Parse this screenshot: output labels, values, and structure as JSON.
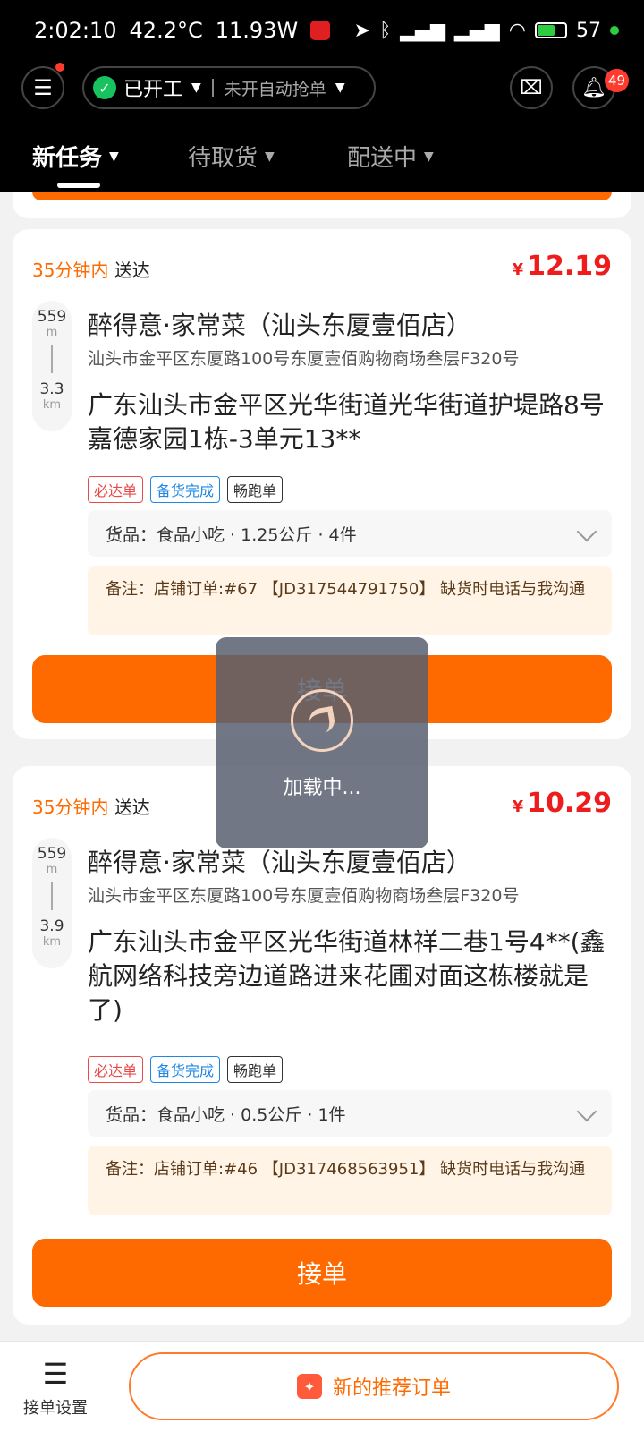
{
  "status_bar": {
    "time": "2:02:10",
    "temp": "42.2°C",
    "power": "11.93W",
    "battery": "57"
  },
  "header": {
    "work_status": "已开工",
    "auto_grab": "未开自动抢单",
    "notification_count": "49"
  },
  "tabs": [
    {
      "label": "新任务",
      "active": true
    },
    {
      "label": "待取货",
      "active": false
    },
    {
      "label": "配送中",
      "active": false
    }
  ],
  "orders": [
    {
      "deliver_time": "35分钟内",
      "deliver_suffix": "送达",
      "price_symbol": "¥",
      "price": "12.19",
      "dist_pickup": "559",
      "dist_pickup_unit": "m",
      "dist_total": "3.3",
      "dist_total_unit": "km",
      "shop_name": "醉得意·家常菜（汕头东厦壹佰店）",
      "shop_address": "汕头市金平区东厦路100号东厦壹佰购物商场叁层F320号",
      "customer_address": "广东汕头市金平区光华街道光华街道护堤路8号嘉德家园1栋-3单元13**",
      "tags": [
        "必达单",
        "备货完成",
        "畅跑单"
      ],
      "goods": "货品：食品小吃 · 1.25公斤 · 4件",
      "remark": "备注：店铺订单:#67 【JD317544791750】 缺货时电话与我沟通",
      "accept_label": "接单"
    },
    {
      "deliver_time": "35分钟内",
      "deliver_suffix": "送达",
      "price_symbol": "¥",
      "price": "10.29",
      "dist_pickup": "559",
      "dist_pickup_unit": "m",
      "dist_total": "3.9",
      "dist_total_unit": "km",
      "shop_name": "醉得意·家常菜（汕头东厦壹佰店）",
      "shop_address": "汕头市金平区东厦路100号东厦壹佰购物商场叁层F320号",
      "customer_address": "广东汕头市金平区光华街道林祥二巷1号4**(鑫航网络科技旁边道路进来花圃对面这栋楼就是了)",
      "tags": [
        "必达单",
        "备货完成",
        "畅跑单"
      ],
      "goods": "货品：食品小吃 · 0.5公斤 · 1件",
      "remark": "备注：店铺订单:#46 【JD317468563951】 缺货时电话与我沟通",
      "accept_label": "接单"
    }
  ],
  "loading": {
    "text": "加载中..."
  },
  "bottom": {
    "settings_label": "接单设置",
    "recommend_label": "新的推荐订单"
  }
}
